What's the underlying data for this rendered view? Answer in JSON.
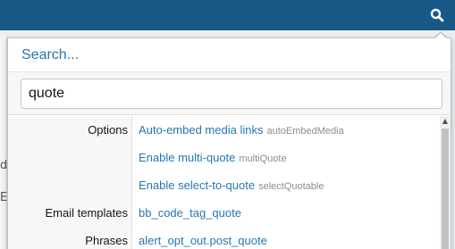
{
  "header": {
    "search_icon": "search-icon"
  },
  "background": {
    "fragment_1": "d",
    "fragment_2": "E"
  },
  "search_popup": {
    "title": "Search...",
    "query": "quote"
  },
  "results": [
    {
      "group": "Options",
      "title": "Auto-embed media links",
      "key": "autoEmbedMedia"
    },
    {
      "group": "",
      "title": "Enable multi-quote",
      "key": "multiQuote"
    },
    {
      "group": "",
      "title": "Enable select-to-quote",
      "key": "selectQuotable"
    },
    {
      "group": "Email templates",
      "title": "bb_code_tag_quote",
      "key": ""
    },
    {
      "group": "Phrases",
      "title": "alert_opt_out.post_quote",
      "key": ""
    }
  ],
  "colors": {
    "header_bg": "#185886",
    "link": "#2577b1",
    "title": "#2577b1"
  }
}
